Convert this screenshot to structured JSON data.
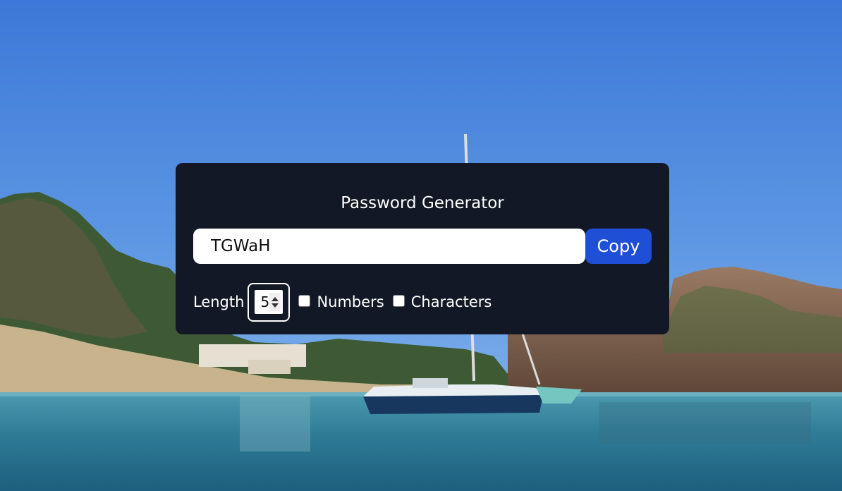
{
  "generator": {
    "title": "Password Generator",
    "password": "TGWaH",
    "copy_label": "Copy",
    "length_label": "Length",
    "length_value": "5",
    "numbers_label": "Numbers",
    "numbers_checked": false,
    "characters_label": "Characters",
    "characters_checked": false
  },
  "colors": {
    "card_bg": "#121826",
    "copy_button_bg": "#1f4fd6",
    "text": "#ffffff",
    "input_bg": "#ffffff"
  }
}
